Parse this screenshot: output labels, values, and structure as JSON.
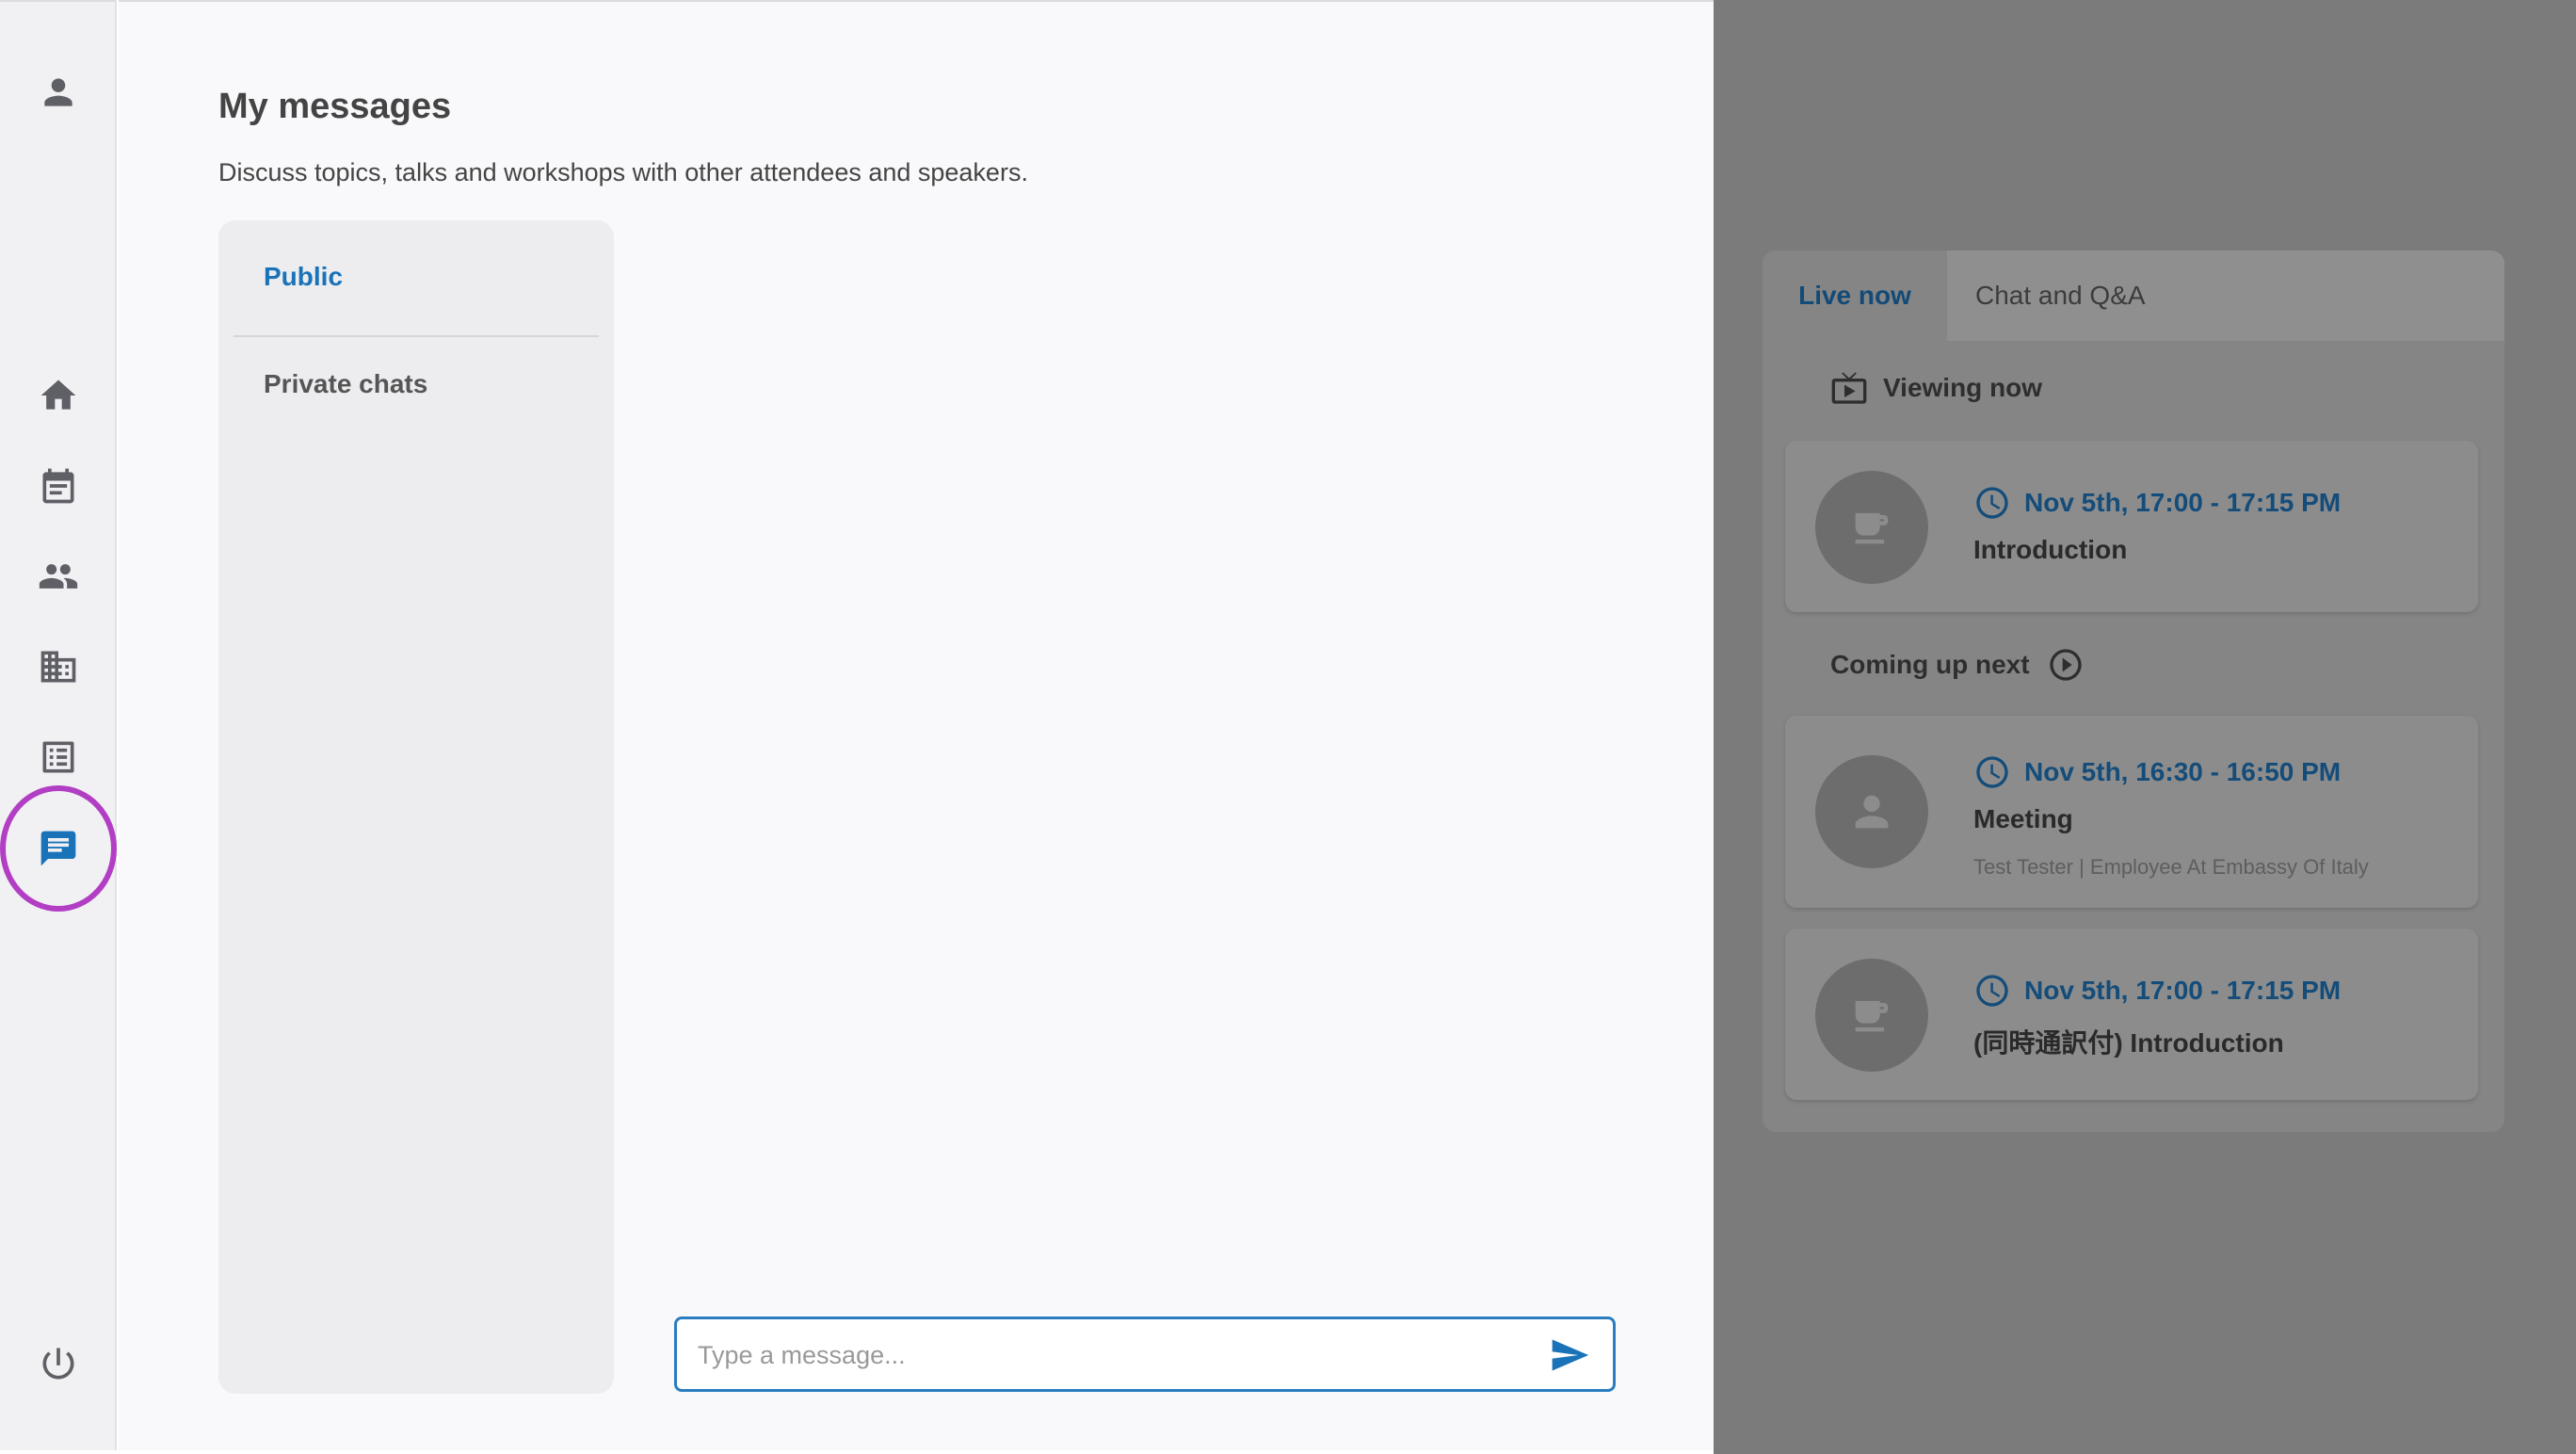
{
  "main": {
    "title": "My messages",
    "subtitle": "Discuss topics, talks and workshops with other attendees and speakers.",
    "channels": {
      "public": "Public",
      "private": "Private chats"
    },
    "composer": {
      "placeholder": "Type a message..."
    }
  },
  "sidebar": {
    "items": [
      "profile-icon",
      "home-icon",
      "calendar-icon",
      "people-icon",
      "building-icon",
      "list-icon",
      "chat-icon",
      "power-icon"
    ],
    "active": "chat-icon",
    "highlight_color": "#b23ec4"
  },
  "panel": {
    "tabs": {
      "live": "Live now",
      "chat": "Chat and Q&A"
    },
    "viewing_now": "Viewing now",
    "coming_up": "Coming up next",
    "now": [
      {
        "time": "Nov 5th, 17:00 - 17:15 PM",
        "title": "Introduction",
        "icon": "coffee-icon"
      }
    ],
    "next": [
      {
        "time": "Nov 5th, 16:30 - 16:50 PM",
        "title": "Meeting",
        "meta": "Test Tester | Employee At Embassy Of Italy",
        "icon": "person-icon"
      },
      {
        "time": "Nov 5th, 17:00 - 17:15 PM",
        "title": "(同時通訳付) Introduction",
        "icon": "coffee-icon"
      }
    ]
  },
  "colors": {
    "accent": "#1a73b8",
    "overlay": "#7b7b7b"
  }
}
